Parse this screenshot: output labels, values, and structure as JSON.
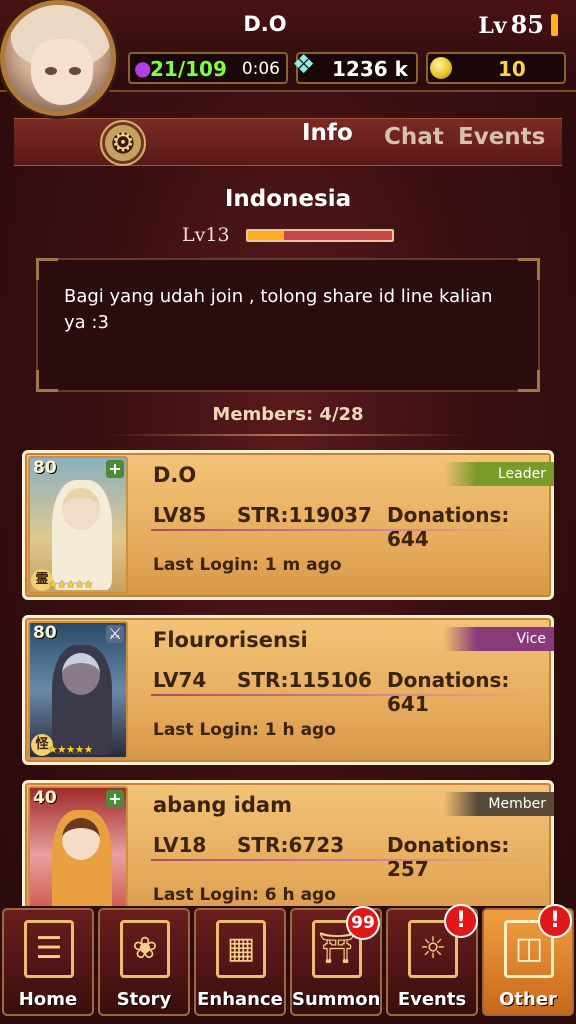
{
  "header": {
    "player_name": "D.O",
    "level_label": "Lv",
    "level_value": "85",
    "energy": "21/109",
    "energy_timer": "0:06",
    "gems": "1236 k",
    "gold": "10"
  },
  "tabs": [
    {
      "label": "Info",
      "active": true
    },
    {
      "label": "Chat",
      "active": false
    },
    {
      "label": "Events",
      "active": false
    }
  ],
  "guild": {
    "name": "Indonesia",
    "level": "Lv13",
    "level_progress": 0.25,
    "message": "Bagi yang udah join , tolong share id line kalian ya :3",
    "members_label": "Members: 4/28"
  },
  "members": [
    {
      "card_level": "80",
      "name": "D.O",
      "role": "Leader",
      "role_color": "#7a9a2a",
      "lv": "LV85",
      "str": "STR:119037",
      "donations": "Donations: 644",
      "last_login": "Last Login: 1 m ago",
      "element_kanji": "霊",
      "stars": "★★★★★"
    },
    {
      "card_level": "80",
      "name": "Flourorisensi",
      "role": "Vice",
      "role_color": "#8a3a7a",
      "lv": "LV74",
      "str": "STR:115106",
      "donations": "Donations: 641",
      "last_login": "Last Login: 1 h ago",
      "element_kanji": "怪",
      "stars": "★★★★★"
    },
    {
      "card_level": "40",
      "name": "abang idam",
      "role": "Member",
      "role_color": "#5a4a3a",
      "lv": "LV18",
      "str": "STR:6723",
      "donations": "Donations: 257",
      "last_login": "Last Login: 6 h ago",
      "element_kanji": "",
      "stars": ""
    }
  ],
  "nav": [
    {
      "label": "Home",
      "icon": "scroll-icon"
    },
    {
      "label": "Story",
      "icon": "book-icon"
    },
    {
      "label": "Enhance",
      "icon": "gold-bars-icon"
    },
    {
      "label": "Summon",
      "icon": "gate-icon",
      "badge": "99"
    },
    {
      "label": "Events",
      "icon": "dragon-icon",
      "badge": "!"
    },
    {
      "label": "Other",
      "icon": "grid-icon",
      "badge": "!",
      "active": true
    }
  ],
  "colors": {
    "accent_gold": "#e8c070",
    "card_bg": "#f2c478",
    "energy_green": "#7cff40",
    "alert_red": "#e01818"
  }
}
